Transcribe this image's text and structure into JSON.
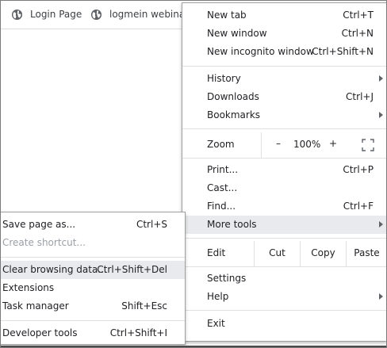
{
  "bookmarks": [
    {
      "label": "Login Page",
      "icon": "globe-icon"
    },
    {
      "label": "logmein webinar",
      "icon": "globe-icon"
    }
  ],
  "main_menu": {
    "new_tab": {
      "label": "New tab",
      "shortcut": "Ctrl+T"
    },
    "new_window": {
      "label": "New window",
      "shortcut": "Ctrl+N"
    },
    "new_incognito": {
      "label": "New incognito window",
      "shortcut": "Ctrl+Shift+N"
    },
    "history": {
      "label": "History"
    },
    "downloads": {
      "label": "Downloads",
      "shortcut": "Ctrl+J"
    },
    "bookmarks": {
      "label": "Bookmarks"
    },
    "zoom": {
      "label": "Zoom",
      "minus": "–",
      "value": "100%",
      "plus": "+"
    },
    "print": {
      "label": "Print...",
      "shortcut": "Ctrl+P"
    },
    "cast": {
      "label": "Cast..."
    },
    "find": {
      "label": "Find...",
      "shortcut": "Ctrl+F"
    },
    "more_tools": {
      "label": "More tools"
    },
    "edit": {
      "label": "Edit",
      "cut": "Cut",
      "copy": "Copy",
      "paste": "Paste"
    },
    "settings": {
      "label": "Settings"
    },
    "help": {
      "label": "Help"
    },
    "exit": {
      "label": "Exit"
    }
  },
  "sub_menu": {
    "save_page": {
      "label": "Save page as...",
      "shortcut": "Ctrl+S"
    },
    "create_shortcut": {
      "label": "Create shortcut..."
    },
    "clear_browsing": {
      "label": "Clear browsing data...",
      "shortcut": "Ctrl+Shift+Del"
    },
    "extensions": {
      "label": "Extensions"
    },
    "task_manager": {
      "label": "Task manager",
      "shortcut": "Shift+Esc"
    },
    "developer_tools": {
      "label": "Developer tools",
      "shortcut": "Ctrl+Shift+I"
    }
  },
  "colors": {
    "hover": "#e8eaed",
    "disabled_text": "#9aa0a6"
  }
}
